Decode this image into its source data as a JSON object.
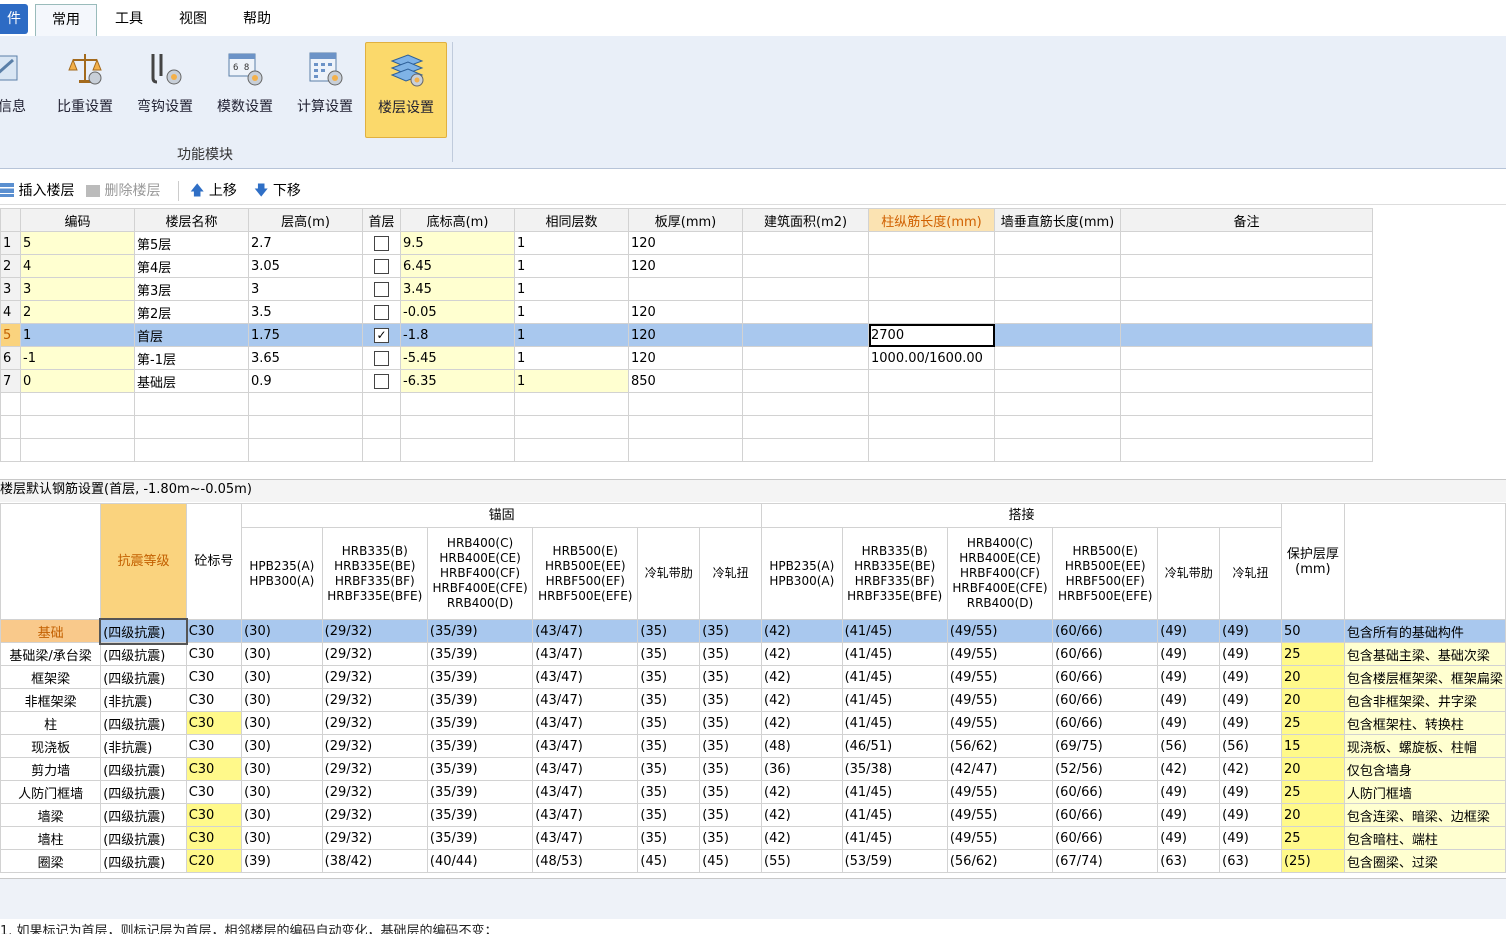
{
  "menu": {
    "file": "件",
    "tabs": [
      "常用",
      "工具",
      "视图",
      "帮助"
    ]
  },
  "ribbon": {
    "buttons": [
      {
        "label": "程信息",
        "icon": "project-info-icon"
      },
      {
        "label": "比重设置",
        "icon": "scale-icon"
      },
      {
        "label": "弯钩设置",
        "icon": "hook-icon"
      },
      {
        "label": "模数设置",
        "icon": "modulus-icon"
      },
      {
        "label": "计算设置",
        "icon": "calculator-icon"
      },
      {
        "label": "楼层设置",
        "icon": "floor-stack-icon"
      }
    ],
    "group_label": "功能模块"
  },
  "toolbar": {
    "insert": "插入楼层",
    "delete": "删除楼层",
    "up": "上移",
    "down": "下移"
  },
  "floor_table": {
    "headers": [
      "编码",
      "楼层名称",
      "层高(m)",
      "首层",
      "底标高(m)",
      "相同层数",
      "板厚(mm)",
      "建筑面积(m2)",
      "柱纵筋长度(mm)",
      "墙垂直筋长度(mm)",
      "备注"
    ],
    "rows": [
      {
        "n": "1",
        "code": "5",
        "name": "第5层",
        "height": "2.7",
        "first": false,
        "elev": "9.5",
        "same": "1",
        "slab": "120",
        "area": "",
        "col": "",
        "wall": "",
        "note": ""
      },
      {
        "n": "2",
        "code": "4",
        "name": "第4层",
        "height": "3.05",
        "first": false,
        "elev": "6.45",
        "same": "1",
        "slab": "120",
        "area": "",
        "col": "",
        "wall": "",
        "note": ""
      },
      {
        "n": "3",
        "code": "3",
        "name": "第3层",
        "height": "3",
        "first": false,
        "elev": "3.45",
        "same": "1",
        "slab": "",
        "area": "",
        "col": "",
        "wall": "",
        "note": ""
      },
      {
        "n": "4",
        "code": "2",
        "name": "第2层",
        "height": "3.5",
        "first": false,
        "elev": "-0.05",
        "same": "1",
        "slab": "120",
        "area": "",
        "col": "",
        "wall": "",
        "note": ""
      },
      {
        "n": "5",
        "code": "1",
        "name": "首层",
        "height": "1.75",
        "first": true,
        "elev": "-1.8",
        "same": "1",
        "slab": "120",
        "area": "",
        "col": "2700",
        "wall": "",
        "note": ""
      },
      {
        "n": "6",
        "code": "-1",
        "name": "第-1层",
        "height": "3.65",
        "first": false,
        "elev": "-5.45",
        "same": "1",
        "slab": "120",
        "area": "",
        "col": "1000.00/1600.00",
        "wall": "",
        "note": ""
      },
      {
        "n": "7",
        "code": "0",
        "name": "基础层",
        "height": "0.9",
        "first": false,
        "elev": "-6.35",
        "same": "1",
        "slab": "850",
        "area": "",
        "col": "",
        "wall": "",
        "note": ""
      }
    ]
  },
  "rebar": {
    "title": "楼层默认钢筋设置(首层, -1.80m~-0.05m)",
    "group_anchor": "锚固",
    "group_lap": "搭接",
    "h_seismic": "抗震等级",
    "h_concrete": "砼标号",
    "h_cover": "保护层厚(mm)",
    "subheaders": [
      "HPB235(A) HPB300(A)",
      "HRB335(B) HRB335E(BE) HRBF335(BF) HRBF335E(BFE)",
      "HRB400(C) HRB400E(CE) HRBF400(CF) HRBF400E(CFE) RRB400(D)",
      "HRB500(E) HRB500E(EE) HRBF500(EF) HRBF500E(EFE)",
      "冷轧带肋",
      "冷轧扭"
    ],
    "rows": [
      {
        "name": "基础",
        "seis": "(四级抗震)",
        "conc": "C30",
        "v": [
          "(30)",
          "(29/32)",
          "(35/39)",
          "(43/47)",
          "(35)",
          "(35)",
          "(42)",
          "(41/45)",
          "(49/55)",
          "(60/66)",
          "(49)",
          "(49)"
        ],
        "cover": "50",
        "note": "包含所有的基础构件"
      },
      {
        "name": "基础梁/承台梁",
        "seis": "(四级抗震)",
        "conc": "C30",
        "v": [
          "(30)",
          "(29/32)",
          "(35/39)",
          "(43/47)",
          "(35)",
          "(35)",
          "(42)",
          "(41/45)",
          "(49/55)",
          "(60/66)",
          "(49)",
          "(49)"
        ],
        "cover": "25",
        "note": "包含基础主梁、基础次梁"
      },
      {
        "name": "框架梁",
        "seis": "(四级抗震)",
        "conc": "C30",
        "v": [
          "(30)",
          "(29/32)",
          "(35/39)",
          "(43/47)",
          "(35)",
          "(35)",
          "(42)",
          "(41/45)",
          "(49/55)",
          "(60/66)",
          "(49)",
          "(49)"
        ],
        "cover": "20",
        "note": "包含楼层框架梁、框架扁梁"
      },
      {
        "name": "非框架梁",
        "seis": "(非抗震)",
        "conc": "C30",
        "v": [
          "(30)",
          "(29/32)",
          "(35/39)",
          "(43/47)",
          "(35)",
          "(35)",
          "(42)",
          "(41/45)",
          "(49/55)",
          "(60/66)",
          "(49)",
          "(49)"
        ],
        "cover": "20",
        "note": "包含非框架梁、井字梁"
      },
      {
        "name": "柱",
        "seis": "(四级抗震)",
        "conc": "C30",
        "v": [
          "(30)",
          "(29/32)",
          "(35/39)",
          "(43/47)",
          "(35)",
          "(35)",
          "(42)",
          "(41/45)",
          "(49/55)",
          "(60/66)",
          "(49)",
          "(49)"
        ],
        "cover": "25",
        "note": "包含框架柱、转换柱"
      },
      {
        "name": "现浇板",
        "seis": "(非抗震)",
        "conc": "C30",
        "v": [
          "(30)",
          "(29/32)",
          "(35/39)",
          "(43/47)",
          "(35)",
          "(35)",
          "(48)",
          "(46/51)",
          "(56/62)",
          "(69/75)",
          "(56)",
          "(56)"
        ],
        "cover": "15",
        "note": "现浇板、螺旋板、柱帽"
      },
      {
        "name": "剪力墙",
        "seis": "(四级抗震)",
        "conc": "C30",
        "v": [
          "(30)",
          "(29/32)",
          "(35/39)",
          "(43/47)",
          "(35)",
          "(35)",
          "(36)",
          "(35/38)",
          "(42/47)",
          "(52/56)",
          "(42)",
          "(42)"
        ],
        "cover": "20",
        "note": "仅包含墙身"
      },
      {
        "name": "人防门框墙",
        "seis": "(四级抗震)",
        "conc": "C30",
        "v": [
          "(30)",
          "(29/32)",
          "(35/39)",
          "(43/47)",
          "(35)",
          "(35)",
          "(42)",
          "(41/45)",
          "(49/55)",
          "(60/66)",
          "(49)",
          "(49)"
        ],
        "cover": "25",
        "note": "人防门框墙"
      },
      {
        "name": "墙梁",
        "seis": "(四级抗震)",
        "conc": "C30",
        "v": [
          "(30)",
          "(29/32)",
          "(35/39)",
          "(43/47)",
          "(35)",
          "(35)",
          "(42)",
          "(41/45)",
          "(49/55)",
          "(60/66)",
          "(49)",
          "(49)"
        ],
        "cover": "20",
        "note": "包含连梁、暗梁、边框梁"
      },
      {
        "name": "墙柱",
        "seis": "(四级抗震)",
        "conc": "C30",
        "v": [
          "(30)",
          "(29/32)",
          "(35/39)",
          "(43/47)",
          "(35)",
          "(35)",
          "(42)",
          "(41/45)",
          "(49/55)",
          "(60/66)",
          "(49)",
          "(49)"
        ],
        "cover": "25",
        "note": "包含暗柱、端柱"
      },
      {
        "name": "圈梁",
        "seis": "(四级抗震)",
        "conc": "C20",
        "v": [
          "(39)",
          "(38/42)",
          "(40/44)",
          "(48/53)",
          "(45)",
          "(45)",
          "(55)",
          "(53/59)",
          "(56/62)",
          "(67/74)",
          "(63)",
          "(63)"
        ],
        "cover": "(25)",
        "note": "包含圈梁、过梁"
      }
    ]
  },
  "footnote": "1. 如果标记为首层，则标记层为首层，相邻楼层的编码自动变化，基础层的编码不变；"
}
